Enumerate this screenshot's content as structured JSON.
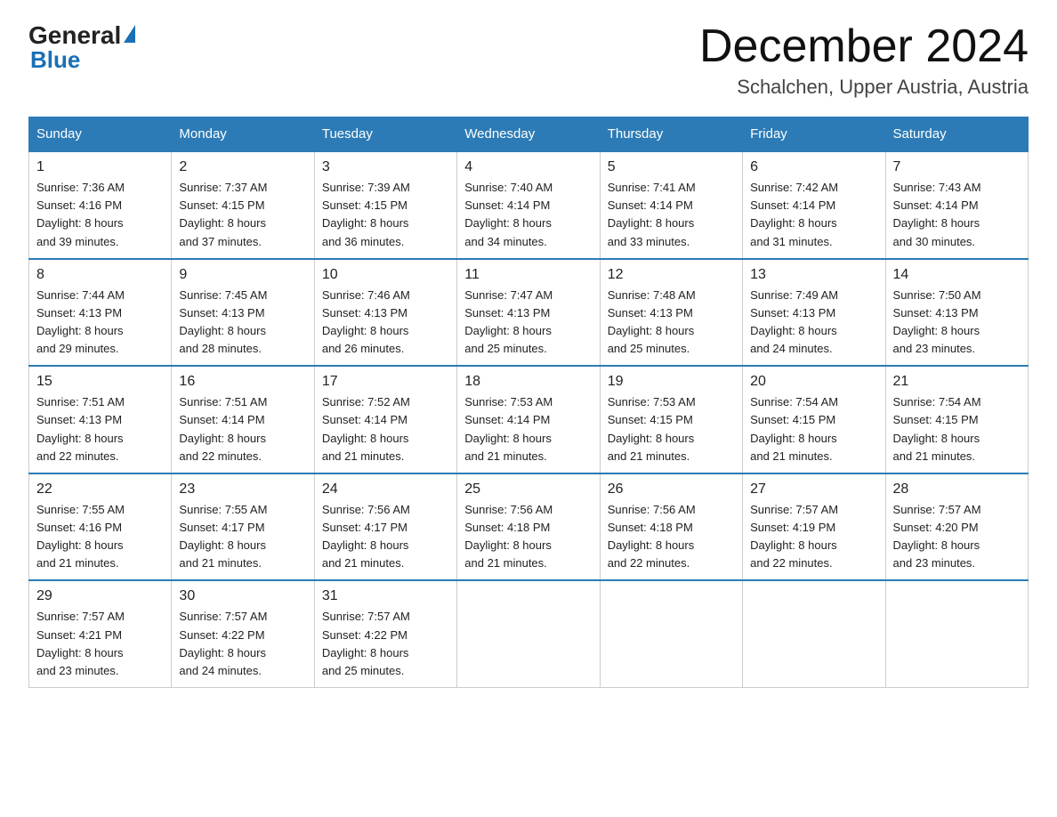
{
  "logo": {
    "general": "General",
    "blue": "Blue"
  },
  "header": {
    "month": "December 2024",
    "location": "Schalchen, Upper Austria, Austria"
  },
  "days_of_week": [
    "Sunday",
    "Monday",
    "Tuesday",
    "Wednesday",
    "Thursday",
    "Friday",
    "Saturday"
  ],
  "weeks": [
    [
      {
        "day": "1",
        "sunrise": "7:36 AM",
        "sunset": "4:16 PM",
        "daylight": "8 hours and 39 minutes."
      },
      {
        "day": "2",
        "sunrise": "7:37 AM",
        "sunset": "4:15 PM",
        "daylight": "8 hours and 37 minutes."
      },
      {
        "day": "3",
        "sunrise": "7:39 AM",
        "sunset": "4:15 PM",
        "daylight": "8 hours and 36 minutes."
      },
      {
        "day": "4",
        "sunrise": "7:40 AM",
        "sunset": "4:14 PM",
        "daylight": "8 hours and 34 minutes."
      },
      {
        "day": "5",
        "sunrise": "7:41 AM",
        "sunset": "4:14 PM",
        "daylight": "8 hours and 33 minutes."
      },
      {
        "day": "6",
        "sunrise": "7:42 AM",
        "sunset": "4:14 PM",
        "daylight": "8 hours and 31 minutes."
      },
      {
        "day": "7",
        "sunrise": "7:43 AM",
        "sunset": "4:14 PM",
        "daylight": "8 hours and 30 minutes."
      }
    ],
    [
      {
        "day": "8",
        "sunrise": "7:44 AM",
        "sunset": "4:13 PM",
        "daylight": "8 hours and 29 minutes."
      },
      {
        "day": "9",
        "sunrise": "7:45 AM",
        "sunset": "4:13 PM",
        "daylight": "8 hours and 28 minutes."
      },
      {
        "day": "10",
        "sunrise": "7:46 AM",
        "sunset": "4:13 PM",
        "daylight": "8 hours and 26 minutes."
      },
      {
        "day": "11",
        "sunrise": "7:47 AM",
        "sunset": "4:13 PM",
        "daylight": "8 hours and 25 minutes."
      },
      {
        "day": "12",
        "sunrise": "7:48 AM",
        "sunset": "4:13 PM",
        "daylight": "8 hours and 25 minutes."
      },
      {
        "day": "13",
        "sunrise": "7:49 AM",
        "sunset": "4:13 PM",
        "daylight": "8 hours and 24 minutes."
      },
      {
        "day": "14",
        "sunrise": "7:50 AM",
        "sunset": "4:13 PM",
        "daylight": "8 hours and 23 minutes."
      }
    ],
    [
      {
        "day": "15",
        "sunrise": "7:51 AM",
        "sunset": "4:13 PM",
        "daylight": "8 hours and 22 minutes."
      },
      {
        "day": "16",
        "sunrise": "7:51 AM",
        "sunset": "4:14 PM",
        "daylight": "8 hours and 22 minutes."
      },
      {
        "day": "17",
        "sunrise": "7:52 AM",
        "sunset": "4:14 PM",
        "daylight": "8 hours and 21 minutes."
      },
      {
        "day": "18",
        "sunrise": "7:53 AM",
        "sunset": "4:14 PM",
        "daylight": "8 hours and 21 minutes."
      },
      {
        "day": "19",
        "sunrise": "7:53 AM",
        "sunset": "4:15 PM",
        "daylight": "8 hours and 21 minutes."
      },
      {
        "day": "20",
        "sunrise": "7:54 AM",
        "sunset": "4:15 PM",
        "daylight": "8 hours and 21 minutes."
      },
      {
        "day": "21",
        "sunrise": "7:54 AM",
        "sunset": "4:15 PM",
        "daylight": "8 hours and 21 minutes."
      }
    ],
    [
      {
        "day": "22",
        "sunrise": "7:55 AM",
        "sunset": "4:16 PM",
        "daylight": "8 hours and 21 minutes."
      },
      {
        "day": "23",
        "sunrise": "7:55 AM",
        "sunset": "4:17 PM",
        "daylight": "8 hours and 21 minutes."
      },
      {
        "day": "24",
        "sunrise": "7:56 AM",
        "sunset": "4:17 PM",
        "daylight": "8 hours and 21 minutes."
      },
      {
        "day": "25",
        "sunrise": "7:56 AM",
        "sunset": "4:18 PM",
        "daylight": "8 hours and 21 minutes."
      },
      {
        "day": "26",
        "sunrise": "7:56 AM",
        "sunset": "4:18 PM",
        "daylight": "8 hours and 22 minutes."
      },
      {
        "day": "27",
        "sunrise": "7:57 AM",
        "sunset": "4:19 PM",
        "daylight": "8 hours and 22 minutes."
      },
      {
        "day": "28",
        "sunrise": "7:57 AM",
        "sunset": "4:20 PM",
        "daylight": "8 hours and 23 minutes."
      }
    ],
    [
      {
        "day": "29",
        "sunrise": "7:57 AM",
        "sunset": "4:21 PM",
        "daylight": "8 hours and 23 minutes."
      },
      {
        "day": "30",
        "sunrise": "7:57 AM",
        "sunset": "4:22 PM",
        "daylight": "8 hours and 24 minutes."
      },
      {
        "day": "31",
        "sunrise": "7:57 AM",
        "sunset": "4:22 PM",
        "daylight": "8 hours and 25 minutes."
      },
      null,
      null,
      null,
      null
    ]
  ],
  "labels": {
    "sunrise": "Sunrise:",
    "sunset": "Sunset:",
    "daylight": "Daylight:"
  }
}
